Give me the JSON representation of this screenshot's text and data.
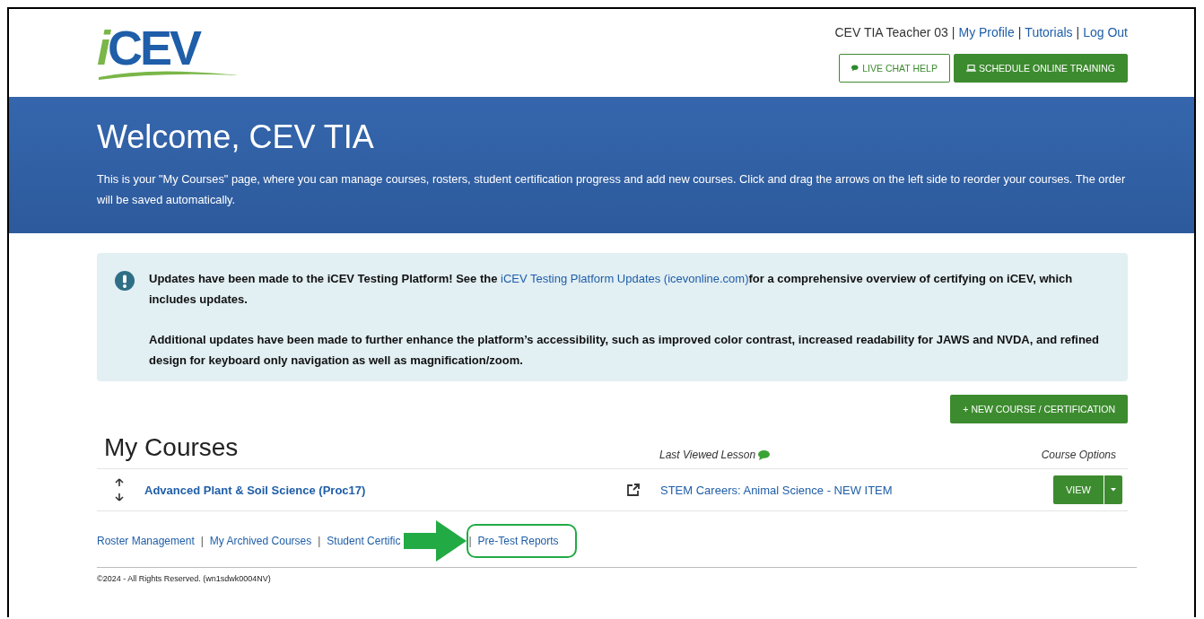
{
  "logo": {
    "lead": "i",
    "rest": "CEV"
  },
  "user_nav": [
    {
      "kind": "text",
      "label": "CEV TIA Teacher 03"
    },
    {
      "kind": "separator",
      "label": "|"
    },
    {
      "kind": "link",
      "label": "My Profile"
    },
    {
      "kind": "separator",
      "label": "|"
    },
    {
      "kind": "link",
      "label": "Tutorials"
    },
    {
      "kind": "separator",
      "label": "|"
    },
    {
      "kind": "link",
      "label": "Log Out"
    }
  ],
  "header_buttons": [
    {
      "kind": "outline",
      "label": "LIVE CHAT HELP"
    },
    {
      "kind": "solid",
      "label": "SCHEDULE ONLINE TRAINING"
    }
  ],
  "banner": {
    "title": "Welcome, CEV TIA",
    "text": "This is your \"My Courses\" page, where you can manage courses, rosters, student certification progress and add new courses. Click and drag the arrows on the left side to reorder your courses. The order will be saved automatically."
  },
  "alert": {
    "before": "Updates have been made to the iCEV Testing Platform! See the ",
    "link": "iCEV Testing Platform Updates (icevonline.com)",
    "after": "for a comprehensive overview of certifying on iCEV, which includes updates.",
    "note": "Additional updates have been made to further enhance the platform’s accessibility, such as improved color contrast, increased readability for JAWS and NVDA, and refined design for keyboard only navigation as well as magnification/zoom."
  },
  "new_course_button": "+ NEW COURSE / CERTIFICATION",
  "courses": {
    "heading": "My Courses",
    "columns": [
      "Last Viewed Lesson",
      "Course Options"
    ],
    "rows": [
      {
        "name": "Advanced Plant & Soil Science (Proc17)",
        "last_lesson": "STEM Careers: Animal Science - NEW ITEM",
        "action": "VIEW"
      }
    ]
  },
  "footer_links": [
    {
      "label": "Roster Management",
      "highlighted": false
    },
    {
      "separator": "|",
      "label": "My Archived Courses",
      "highlighted": false
    },
    {
      "separator": "|",
      "label": "Student Certific",
      "highlighted": false
    },
    {
      "separator": "|",
      "label": "Pre-Test Reports",
      "highlighted": true
    }
  ],
  "copyright": "©2024 - All Rights Reserved. (wn1sdwk0004NV)"
}
